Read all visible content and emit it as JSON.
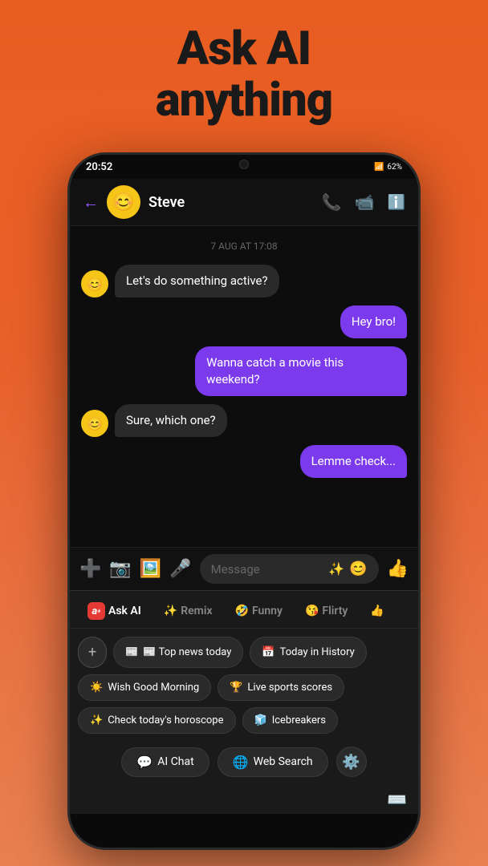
{
  "header": {
    "line1": "Ask AI",
    "line2": "anything"
  },
  "phone": {
    "time": "20:52",
    "battery": "62%",
    "contact": {
      "name": "Steve",
      "avatar_emoji": "😊"
    },
    "chat": {
      "timestamp": "7 AUG AT 17:08",
      "messages": [
        {
          "id": 1,
          "type": "incoming",
          "text": "Let's do something active?",
          "show_avatar": true
        },
        {
          "id": 2,
          "type": "outgoing",
          "text": "Hey bro!"
        },
        {
          "id": 3,
          "type": "outgoing",
          "text": "Wanna catch a movie this weekend?"
        },
        {
          "id": 4,
          "type": "incoming",
          "text": "Sure, which one?",
          "show_avatar": true
        },
        {
          "id": 5,
          "type": "outgoing",
          "text": "Lemme check..."
        }
      ]
    },
    "input_placeholder": "Message",
    "ai_panel": {
      "tabs": [
        {
          "id": "ask_ai",
          "label": "Ask AI",
          "icon": "🅰",
          "active": true
        },
        {
          "id": "remix",
          "label": "Remix",
          "icon": "✨"
        },
        {
          "id": "funny",
          "label": "Funny",
          "icon": "🤣"
        },
        {
          "id": "flirty",
          "label": "Flirty",
          "icon": "😘"
        },
        {
          "id": "more",
          "label": "",
          "icon": "👍"
        }
      ],
      "chips": [
        [
          {
            "id": "add",
            "label": "+",
            "type": "add"
          },
          {
            "id": "top_news",
            "label": "📰 Top news today"
          },
          {
            "id": "today_history",
            "label": "📅 Today in History"
          }
        ],
        [
          {
            "id": "good_morning",
            "label": "☀️ Wish Good Morning"
          },
          {
            "id": "sports",
            "label": "🏆 Live sports scores"
          }
        ],
        [
          {
            "id": "horoscope",
            "label": "✨ Check today's horoscope"
          },
          {
            "id": "icebreakers",
            "label": "🧊 Icebreakers"
          }
        ]
      ],
      "actions": [
        {
          "id": "ai_chat",
          "label": "AI Chat",
          "icon": "💬"
        },
        {
          "id": "web_search",
          "label": "Web Search",
          "icon": "🌐"
        }
      ],
      "settings_icon": "⚙️"
    }
  }
}
